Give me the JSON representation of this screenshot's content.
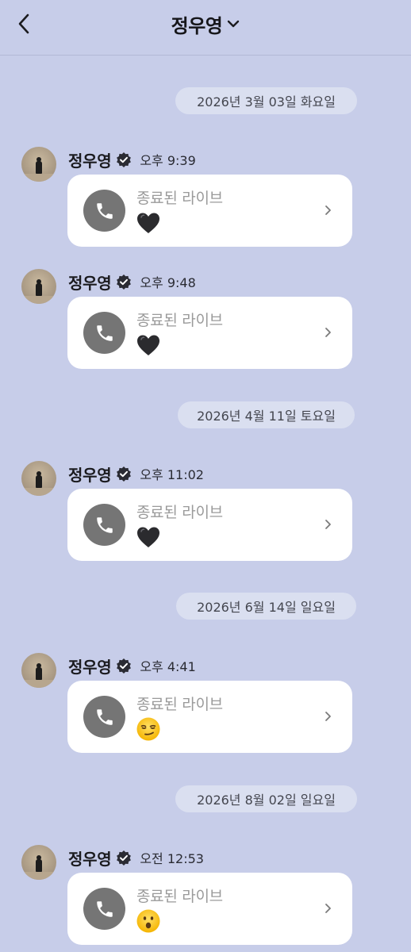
{
  "header": {
    "title": "정우영"
  },
  "dates": [
    "2026년 3월 03일 화요일",
    "2026년 4월 11일 토요일",
    "2026년 6월 14일 일요일",
    "2026년 8월 02일 일요일"
  ],
  "messages": [
    {
      "sender": "정우영",
      "time": "오후 9:39",
      "label": "종료된 라이브",
      "emoji": "black-heart"
    },
    {
      "sender": "정우영",
      "time": "오후 9:48",
      "label": "종료된 라이브",
      "emoji": "black-heart"
    },
    {
      "sender": "정우영",
      "time": "오후 11:02",
      "label": "종료된 라이브",
      "emoji": "black-heart"
    },
    {
      "sender": "정우영",
      "time": "오후 4:41",
      "label": "종료된 라이브",
      "emoji": "smirking-face"
    },
    {
      "sender": "정우영",
      "time": "오전 12:53",
      "label": "종료된 라이브",
      "emoji": "hushed-face"
    }
  ],
  "colors": {
    "background": "#c7cde9",
    "card": "#ffffff",
    "call_icon_bg": "#757575",
    "date_pill": "#dadff0"
  }
}
